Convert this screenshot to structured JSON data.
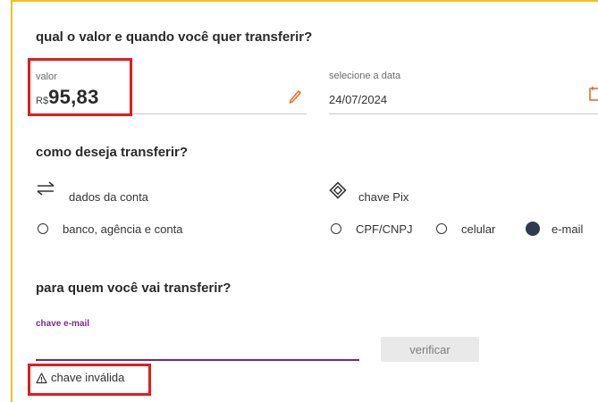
{
  "section_amount": {
    "title": "qual o valor e quando você quer transferir?",
    "value_label": "valor",
    "currency": "R$",
    "value": "95,83",
    "date_label": "selecione a data",
    "date_value": "24/07/2024"
  },
  "section_method": {
    "title": "como deseja transferir?",
    "account_label": "dados da conta",
    "account_option": "banco, agência e conta",
    "pix_label": "chave Pix",
    "pix_options": [
      "CPF/CNPJ",
      "celular",
      "e-mail"
    ],
    "pix_selected": "e-mail"
  },
  "section_recipient": {
    "title": "para quem você vai transferir?",
    "key_label": "chave e-mail",
    "key_value": "",
    "verify_label": "verificar",
    "error_text": "chave inválida"
  },
  "colors": {
    "highlight_red": "#e31b1b",
    "accent_yellow": "#f3c21a",
    "accent_purple": "#6b2b87",
    "edit_orange": "#e8702a"
  }
}
